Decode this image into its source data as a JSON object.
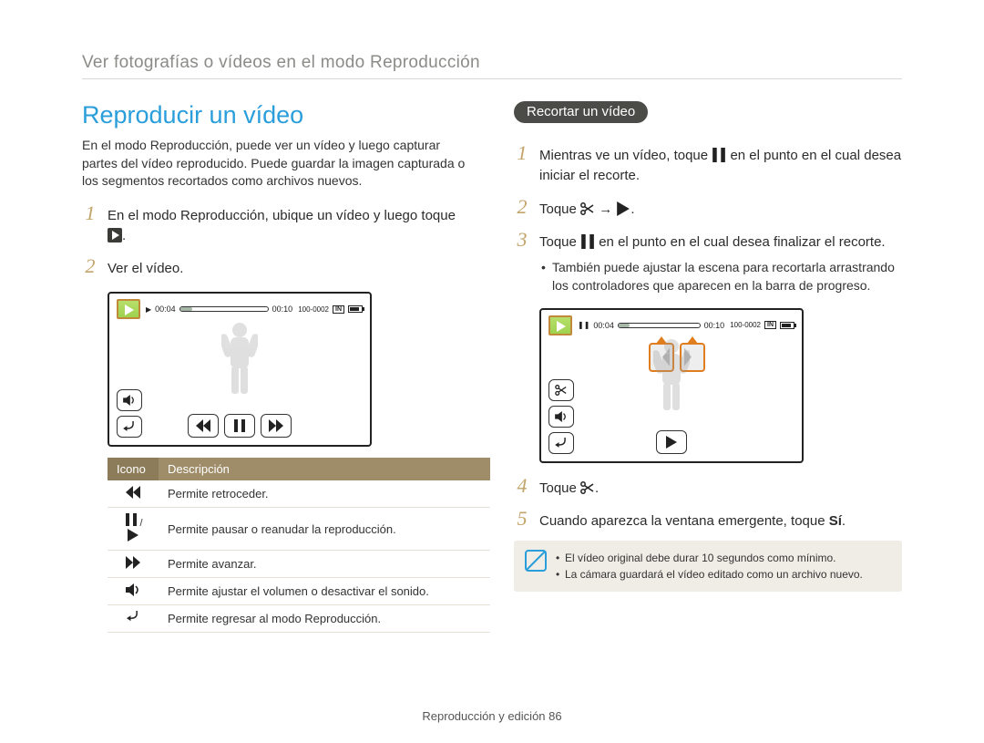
{
  "breadcrumb": "Ver fotografías o vídeos en el modo Reproducción",
  "left": {
    "title": "Reproducir un vídeo",
    "intro": "En el modo Reproducción, puede ver un vídeo y luego capturar partes del vídeo reproducido. Puede guardar la imagen capturada o los segmentos recortados como archivos nuevos.",
    "step1_a": "En el modo Reproducción, ubique un vídeo y luego toque ",
    "step1_b": ".",
    "step2": "Ver el vídeo.",
    "shot": {
      "time_current": "00:04",
      "time_total": "00:10",
      "file_no": "100-0002",
      "card": "IN"
    },
    "table": {
      "h_icon": "Icono",
      "h_desc": "Descripción",
      "r1": "Permite retroceder.",
      "r2": "Permite pausar o reanudar la reproducción.",
      "r3": "Permite avanzar.",
      "r4": "Permite ajustar el volumen o desactivar el sonido.",
      "r5": "Permite regresar al modo Reproducción."
    }
  },
  "right": {
    "pill": "Recortar un vídeo",
    "s1_a": "Mientras ve un vídeo, toque ",
    "s1_b": " en el punto en el cual desea iniciar el recorte.",
    "s2_a": "Toque ",
    "s2_b": " → ",
    "s2_c": ".",
    "s3_a": "Toque ",
    "s3_b": " en el punto en el cual desea finalizar el recorte.",
    "bullet1": "También puede ajustar la escena para recortarla arrastrando los controladores que aparecen en la barra de progreso.",
    "shot": {
      "time_current": "00:04",
      "time_total": "00:10",
      "file_no": "100-0002",
      "card": "IN"
    },
    "s4_a": "Toque ",
    "s4_b": ".",
    "s5_a": "Cuando aparezca la ventana emergente, toque ",
    "s5_bold": "Sí",
    "s5_b": ".",
    "note1": "El vídeo original debe durar 10 segundos como mínimo.",
    "note2": "La cámara guardará el vídeo editado como un archivo nuevo."
  },
  "footer_a": "Reproducción y edición  ",
  "footer_b": "86"
}
